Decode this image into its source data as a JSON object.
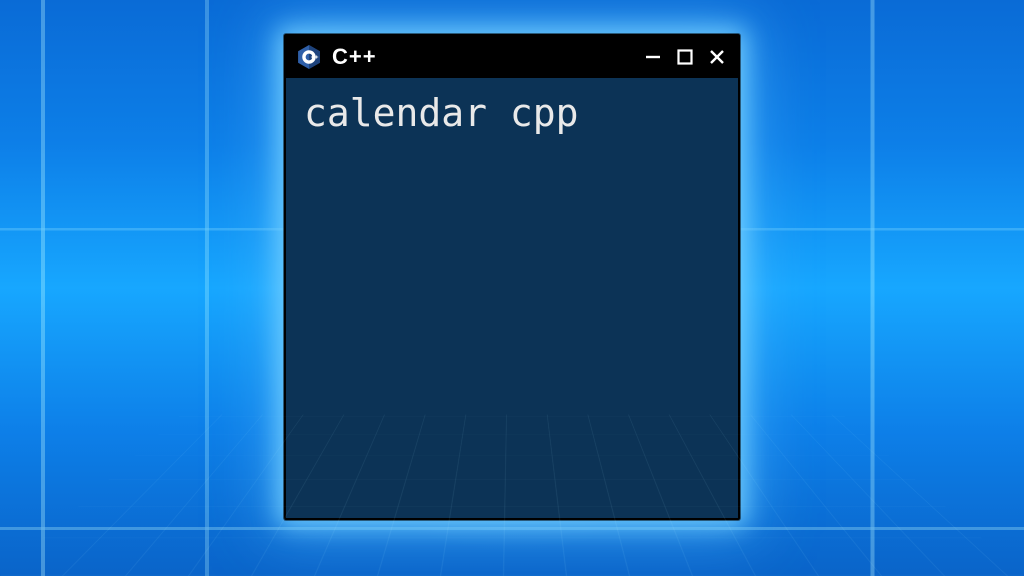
{
  "colors": {
    "window_body": "#0c3356",
    "titlebar": "#000000",
    "text": "#e9e9e9"
  },
  "titlebar": {
    "icon_name": "cpp-logo-icon",
    "title": "C++"
  },
  "window_controls": {
    "minimize": "–",
    "maximize": "□",
    "close": "✕"
  },
  "terminal": {
    "lines": [
      "calendar cpp"
    ]
  }
}
